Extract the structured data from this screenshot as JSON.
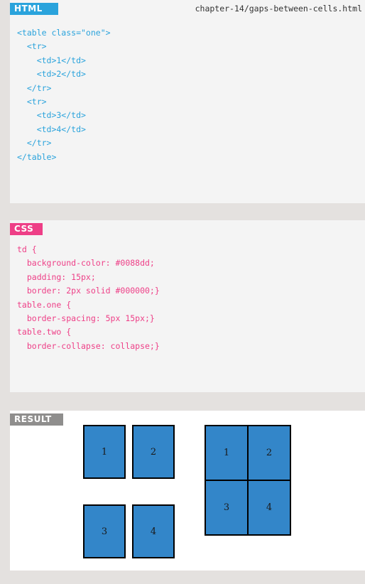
{
  "html_panel": {
    "tab_label": "HTML",
    "filename": "chapter-14/gaps-between-cells.html",
    "code_lines": [
      "<table class=\"one\">",
      "  <tr>",
      "    <td>1</td>",
      "    <td>2</td>",
      "  </tr>",
      "  <tr>",
      "    <td>3</td>",
      "    <td>4</td>",
      "  </tr>",
      "</table>"
    ]
  },
  "css_panel": {
    "tab_label": "CSS",
    "code_lines": [
      "td {",
      "  background-color: #0088dd;",
      "  padding: 15px;",
      "  border: 2px solid #000000;}",
      "table.one {",
      "  border-spacing: 5px 15px;}",
      "table.two {",
      "  border-collapse: collapse;}"
    ]
  },
  "result_panel": {
    "tab_label": "RESULT",
    "table_one": {
      "rows": [
        [
          "1",
          "2"
        ],
        [
          "3",
          "4"
        ]
      ]
    },
    "table_two": {
      "rows": [
        [
          "1",
          "2"
        ],
        [
          "3",
          "4"
        ]
      ]
    }
  },
  "colors": {
    "html_accent": "#2aa3dc",
    "css_accent": "#ee3f87",
    "result_accent": "#8f8e8d",
    "cell_background": "#3386c9"
  }
}
